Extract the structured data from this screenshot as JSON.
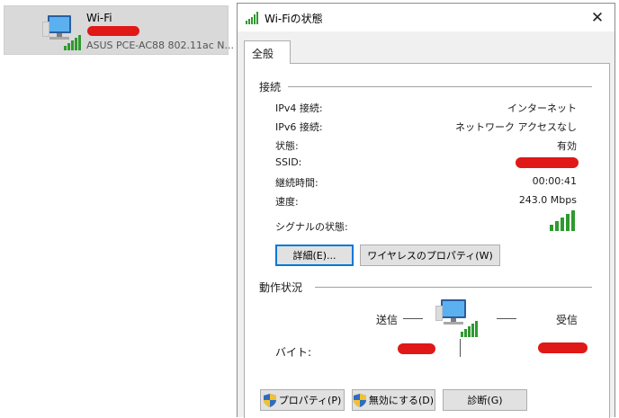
{
  "network_tile": {
    "name": "Wi-Fi",
    "adapter": "ASUS PCE-AC88 802.11ac N..."
  },
  "dialog": {
    "title": "Wi-Fiの状態",
    "close_glyph": "✕",
    "tab": "全般",
    "connection": {
      "header": "接続",
      "rows": [
        {
          "label": "IPv4 接続:",
          "value": "インターネット"
        },
        {
          "label": "IPv6 接続:",
          "value": "ネットワーク アクセスなし"
        },
        {
          "label": "状態:",
          "value": "有効"
        },
        {
          "label": "SSID:",
          "value": ""
        },
        {
          "label": "継続時間:",
          "value": "00:00:41"
        },
        {
          "label": "速度:",
          "value": "243.0 Mbps"
        }
      ],
      "signal_label": "シグナルの状態:",
      "signal_bars": 5
    },
    "buttons": {
      "details": "詳細(E)...",
      "wireless_properties": "ワイヤレスのプロパティ(W)"
    },
    "activity": {
      "header": "動作状況",
      "sent": "送信",
      "received": "受信",
      "bytes_label": "バイト:"
    },
    "bottom_buttons": {
      "properties": "プロパティ(P)",
      "disable": "無効にする(D)",
      "diagnose": "診断(G)"
    }
  },
  "colors": {
    "signal": "#2e9a2e",
    "redaction": "#e01818",
    "focus": "#0078d7"
  }
}
